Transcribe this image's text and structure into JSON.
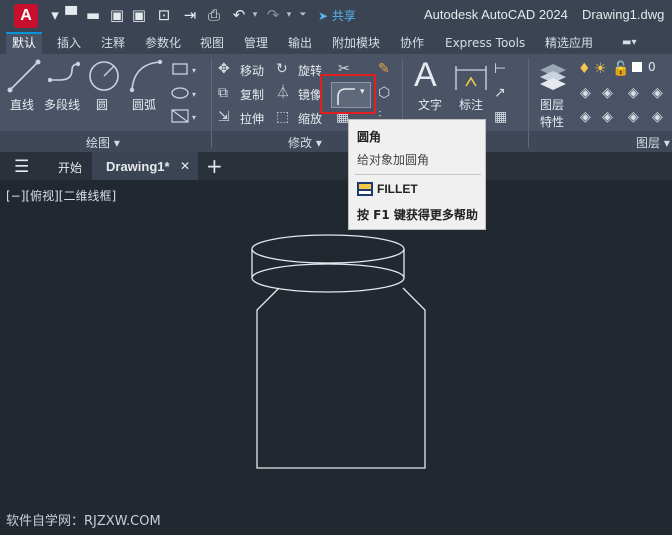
{
  "app": {
    "logo": "A",
    "share": "共享",
    "title": "Autodesk AutoCAD 2024",
    "document": "Drawing1.dwg"
  },
  "ribbon_tabs": [
    {
      "label": "默认",
      "active": true
    },
    {
      "label": "插入"
    },
    {
      "label": "注释"
    },
    {
      "label": "参数化"
    },
    {
      "label": "视图"
    },
    {
      "label": "管理"
    },
    {
      "label": "输出"
    },
    {
      "label": "附加模块"
    },
    {
      "label": "协作"
    },
    {
      "label": "Express Tools"
    },
    {
      "label": "精选应用"
    }
  ],
  "draw_panel": {
    "name": "绘图",
    "line": "直线",
    "polyline": "多段线",
    "circle": "圆",
    "arc": "圆弧"
  },
  "modify_panel": {
    "name": "修改",
    "move": "移动",
    "rotate": "旋转",
    "copy": "复制",
    "mirror": "镜像",
    "stretch": "拉伸",
    "scale": "缩放"
  },
  "annotation_panel": {
    "text": "文字",
    "dimension": "标注"
  },
  "layers_panel": {
    "name": "图层",
    "layer_props_line1": "图层",
    "layer_props_line2": "特性"
  },
  "doc_tabs": {
    "start": "开始",
    "drawing": "Drawing1*"
  },
  "viewport_label": "[−][俯视][二维线框]",
  "tooltip": {
    "title": "圆角",
    "description": "给对象加圆角",
    "command": "FILLET",
    "help": "按 F1 键获得更多帮助"
  },
  "watermark": "软件自学网：RJZXW.COM",
  "colors": {
    "accent": "#0696d7",
    "highlight": "#e02020",
    "logo": "#c8102e"
  }
}
